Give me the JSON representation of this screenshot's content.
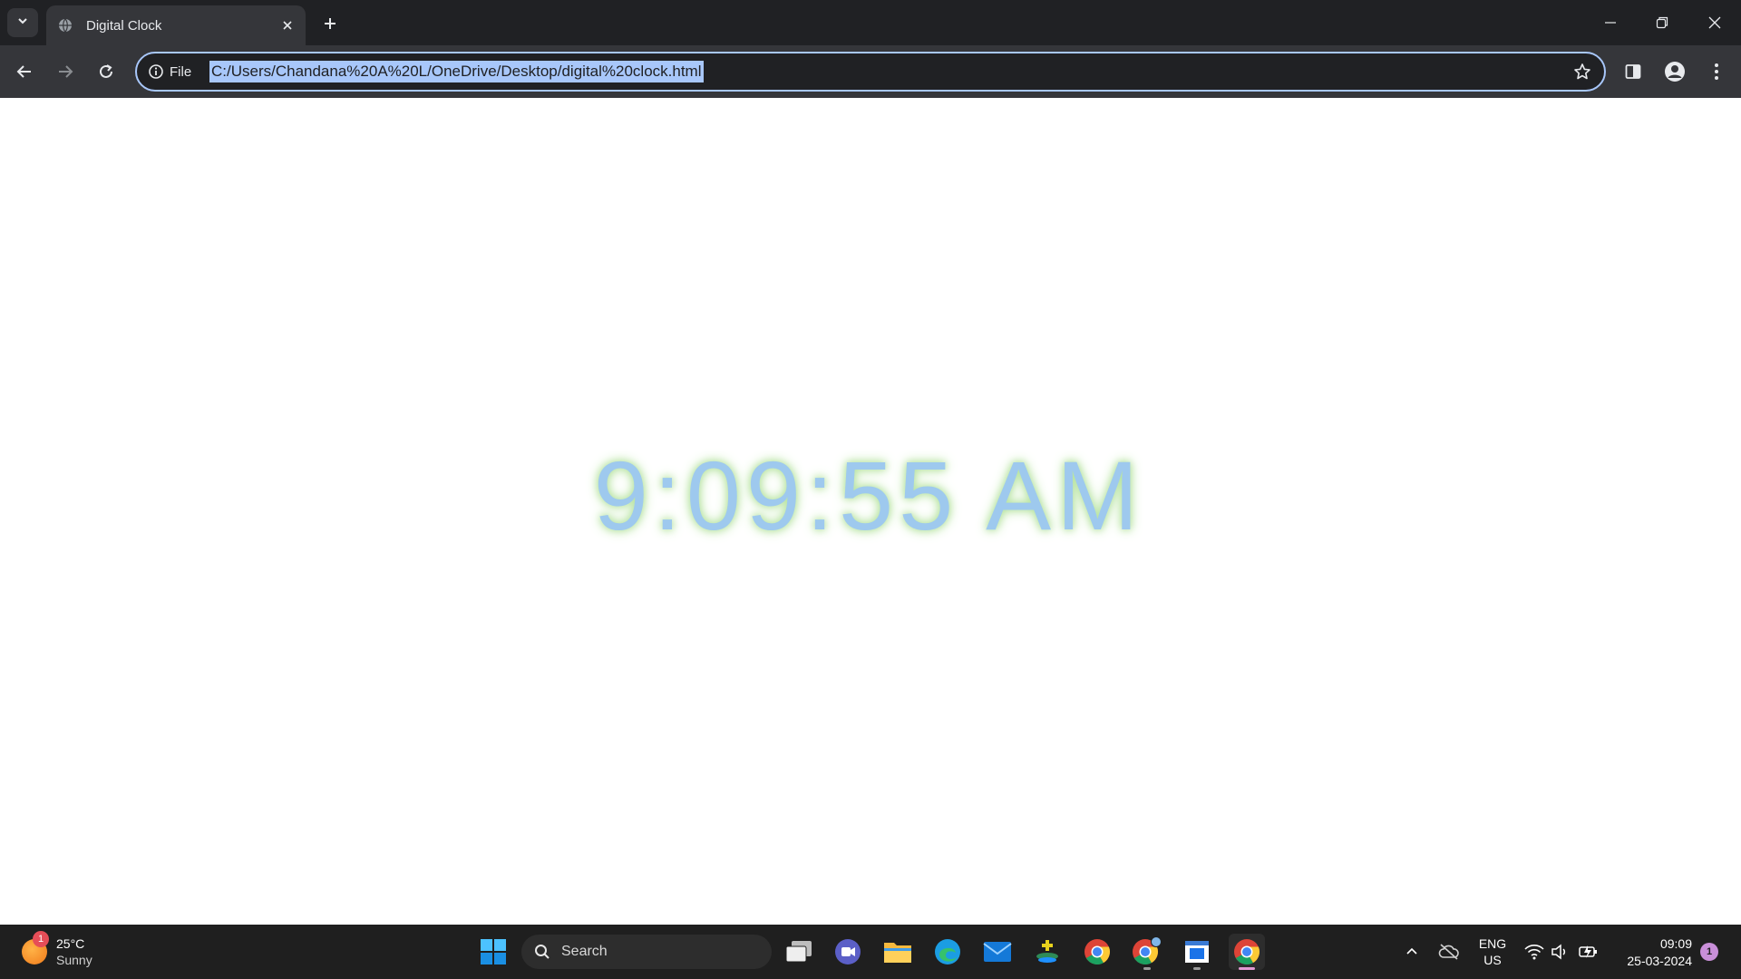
{
  "browser": {
    "tab": {
      "title": "Digital Clock"
    },
    "address_bar": {
      "site_chip_label": "File",
      "url": "C:/Users/Chandana%20A%20L/OneDrive/Desktop/digital%20clock.html"
    },
    "icons": {
      "tab_search": "chevron-down-icon",
      "favicon": "globe-icon",
      "tab_close": "close-icon",
      "new_tab": "plus-icon",
      "minimize": "minimize-icon",
      "restore": "restore-icon",
      "close_window": "close-icon",
      "back": "back-arrow-icon",
      "forward": "forward-arrow-icon",
      "reload": "reload-icon",
      "info": "info-icon",
      "bookmark": "star-icon",
      "side_panel": "side-panel-icon",
      "profile": "profile-icon",
      "menu": "kebab-menu-icon"
    }
  },
  "page": {
    "clock_time": "9:09:55 AM",
    "clock_color": "#9ec9ee",
    "glow_color": "#b6e3a0"
  },
  "taskbar": {
    "weather": {
      "badge": "1",
      "temperature": "25°C",
      "condition": "Sunny"
    },
    "search_label": "Search",
    "pinned_apps": [
      "windows-start-icon",
      "task-view-icon",
      "meet-icon",
      "file-explorer-icon",
      "edge-icon",
      "mail-icon",
      "app-icon",
      "chrome-icon",
      "chrome-profile-icon",
      "notepad-icon",
      "chrome-active-icon"
    ],
    "tray": {
      "language_line1": "ENG",
      "language_line2": "US",
      "time": "09:09",
      "date": "25-03-2024",
      "notification_count": "1"
    }
  }
}
